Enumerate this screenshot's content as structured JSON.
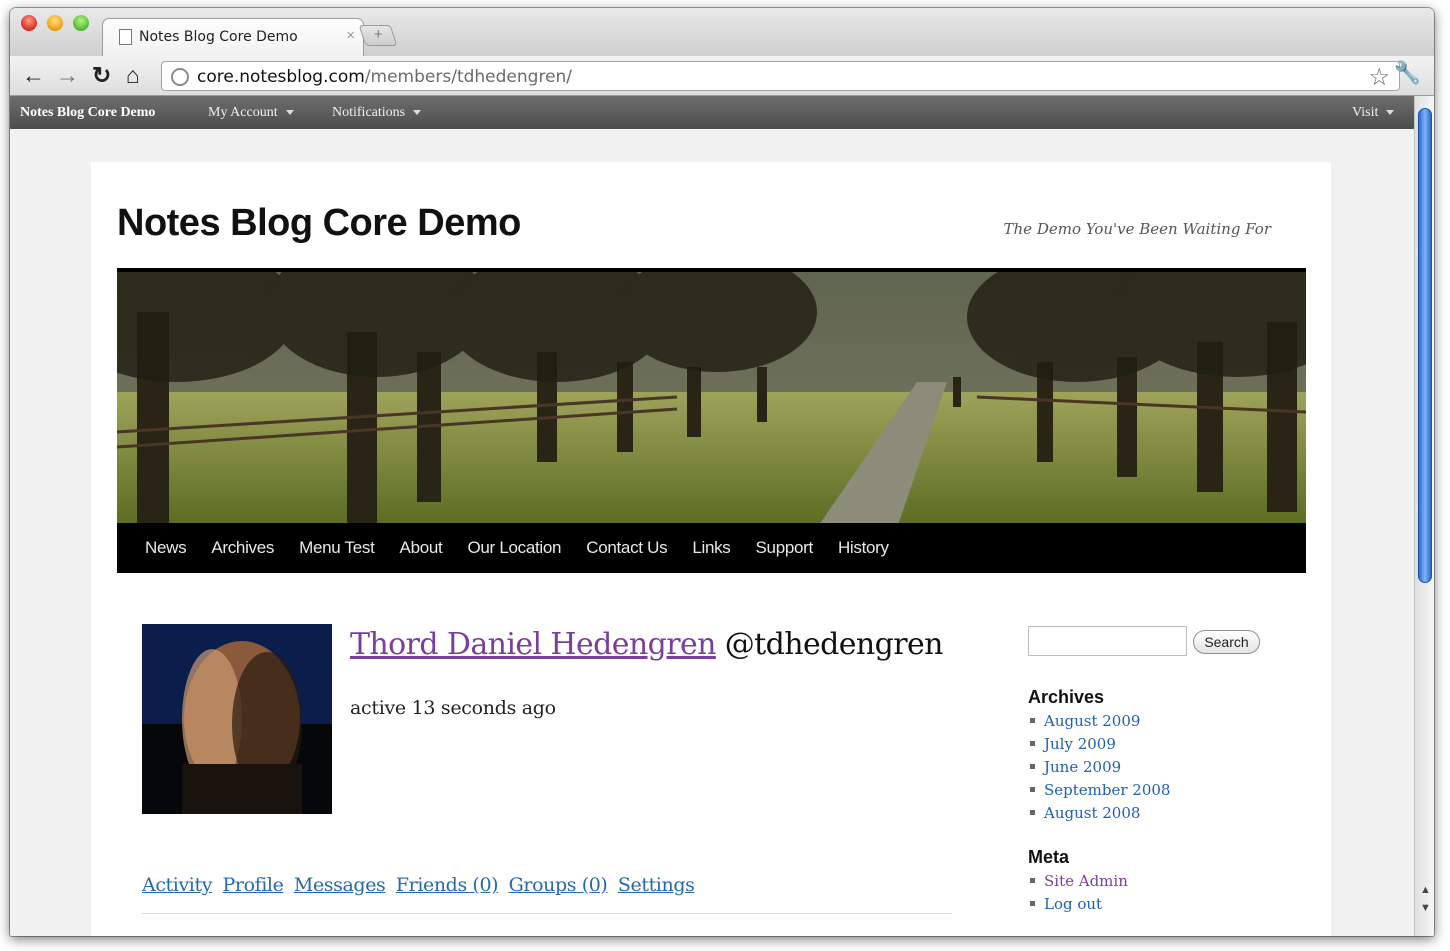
{
  "browser": {
    "tab_title": "Notes Blog Core Demo",
    "tab_close": "×",
    "new_tab": "+",
    "url_domain": "core.notesblog.com",
    "url_path": "/members/tdhedengren/"
  },
  "adminbar": {
    "brand": "Notes Blog Core Demo",
    "my_account": "My Account",
    "notifications": "Notifications",
    "visit": "Visit"
  },
  "site": {
    "title": "Notes Blog Core Demo",
    "tagline": "The Demo You've Been Waiting For"
  },
  "mainnav": [
    "News",
    "Archives",
    "Menu Test",
    "About",
    "Our Location",
    "Contact Us",
    "Links",
    "Support",
    "History"
  ],
  "member": {
    "name": "Thord Daniel Hedengren",
    "handle": "@tdhedengren",
    "activity": "active 13 seconds ago"
  },
  "subnav": [
    "Activity",
    "Profile",
    "Messages",
    "Friends (0)",
    "Groups (0)",
    "Settings"
  ],
  "sidebar": {
    "search_button": "Search",
    "archives_title": "Archives",
    "archives": [
      "August 2009",
      "July 2009",
      "June 2009",
      "September 2008",
      "August 2008"
    ],
    "meta_title": "Meta",
    "meta": [
      "Site Admin",
      "Log out"
    ]
  },
  "icons": {
    "back": "back-arrow-icon",
    "forward": "forward-arrow-icon",
    "reload": "reload-icon",
    "home": "home-icon",
    "bookmark": "star-icon",
    "settings": "wrench-icon"
  }
}
